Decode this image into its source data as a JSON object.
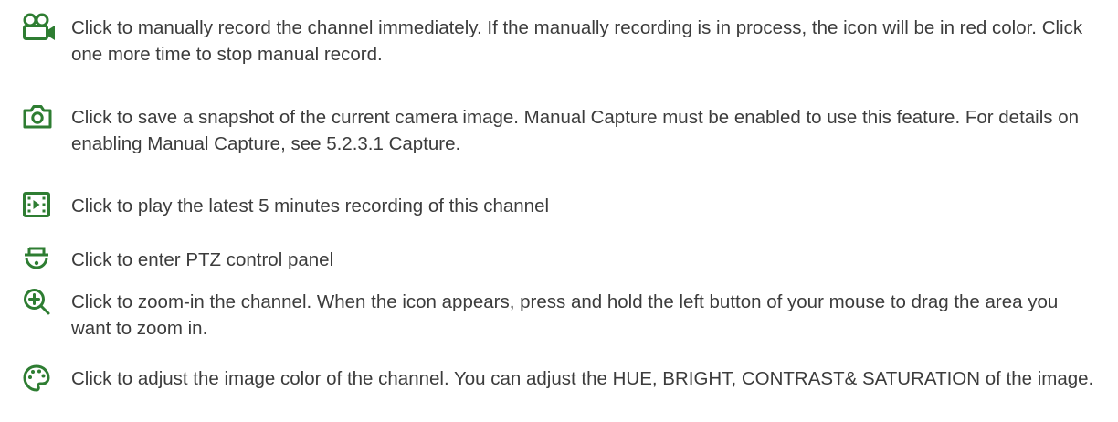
{
  "icon_color": "#2e7d32",
  "items": [
    {
      "icon": "video-camera-icon",
      "text": "Click to manually record the channel immediately. If the manually recording is in process, the icon will be in red color. Click one more time to stop manual record."
    },
    {
      "icon": "camera-icon",
      "text": "Click to save a snapshot of the current camera image. Manual Capture must be enabled to use this feature. For details on enabling Manual Capture, see 5.2.3.1 Capture."
    },
    {
      "icon": "playback-icon",
      "text": "Click to play the latest 5 minutes recording of this channel"
    },
    {
      "icon": "ptz-dome-icon",
      "text": "Click to enter PTZ control panel"
    },
    {
      "icon": "zoom-in-icon",
      "text": "Click to zoom-in the channel. When the  icon appears, press and hold the left button of your mouse to drag the area you want to zoom in."
    },
    {
      "icon": "color-palette-icon",
      "text": "Click to adjust the image color of the channel. You can adjust the HUE, BRIGHT, CONTRAST& SATURATION of the image."
    }
  ]
}
